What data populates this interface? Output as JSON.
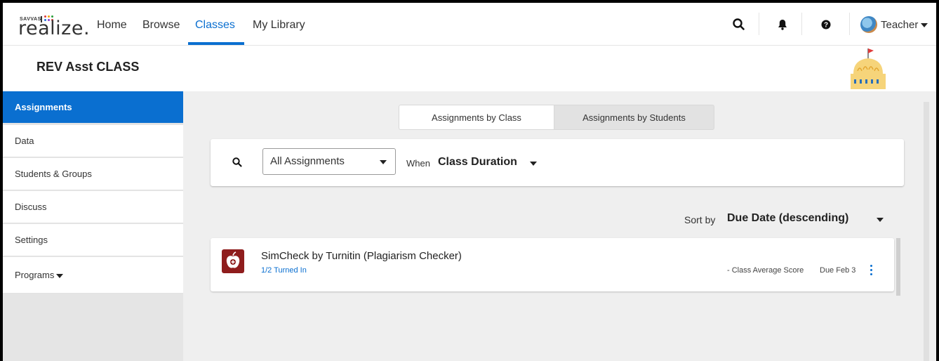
{
  "brand": {
    "small": "SAVVAS",
    "word": "realize."
  },
  "nav": {
    "links": [
      {
        "label": "Home"
      },
      {
        "label": "Browse"
      },
      {
        "label": "Classes"
      },
      {
        "label": "My Library"
      }
    ],
    "active": "Classes",
    "user_label": "Teacher"
  },
  "class_name": "REV Asst CLASS",
  "sidebar": {
    "items": [
      {
        "label": "Assignments"
      },
      {
        "label": "Data"
      },
      {
        "label": "Students & Groups"
      },
      {
        "label": "Discuss"
      },
      {
        "label": "Settings"
      },
      {
        "label": "Programs"
      }
    ],
    "active": "Assignments"
  },
  "view_toggle": {
    "selected": "Assignments by Class",
    "other": "Assignments by Students"
  },
  "filters": {
    "type_value": "All Assignments",
    "when_label": "When",
    "when_value": "Class Duration"
  },
  "sort": {
    "label": "Sort by",
    "value": "Due Date (descending)"
  },
  "assignments": [
    {
      "title": "SimCheck by Turnitin (Plagiarism Checker)",
      "status": "1/2 Turned In",
      "score": "- Class Average Score",
      "due": "Due Feb 3"
    }
  ],
  "colors": {
    "accent": "#0a6fd0",
    "assignment_icon": "#8f1d1d"
  },
  "icons": [
    "search-icon",
    "bell-icon",
    "help-icon",
    "caret-down-icon",
    "apple-icon",
    "kebab-menu-icon",
    "capitol-dome-icon"
  ]
}
